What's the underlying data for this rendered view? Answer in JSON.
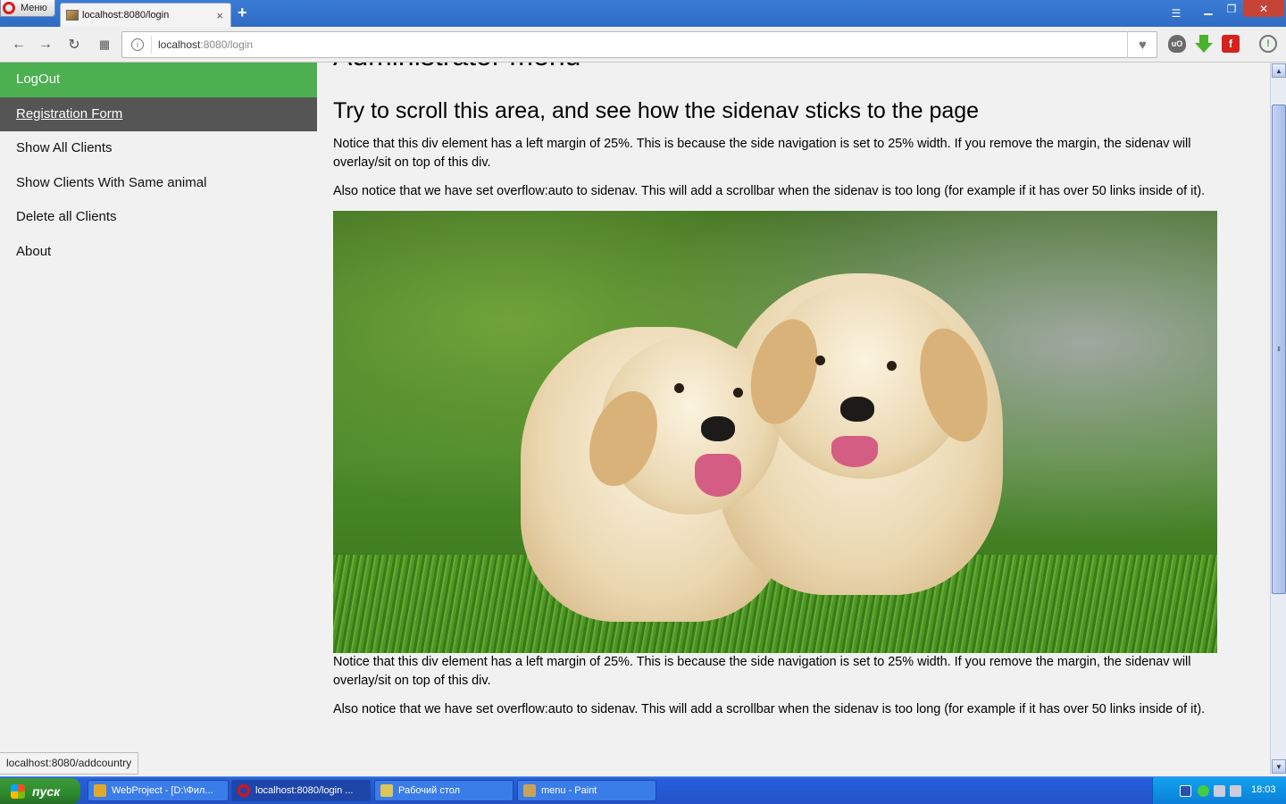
{
  "browser": {
    "menu_label": "Меню",
    "tab_title": "localhost:8080/login",
    "tab_close": "×",
    "new_tab": "+",
    "url_host": "localhost",
    "url_path": ":8080/login",
    "status_url": "localhost:8080/addcountry"
  },
  "sidenav": {
    "items": [
      {
        "label": "LogOut"
      },
      {
        "label": "Registration Form"
      },
      {
        "label": "Show All Clients"
      },
      {
        "label": "Show Clients With Same animal"
      },
      {
        "label": "Delete all Clients"
      },
      {
        "label": "About"
      }
    ]
  },
  "main": {
    "h1": "Administrator menu",
    "h2": "Try to scroll this area, and see how the sidenav sticks to the page",
    "p1": "Notice that this div element has a left margin of 25%. This is because the side navigation is set to 25% width. If you remove the margin, the sidenav will overlay/sit on top of this div.",
    "p2": "Also notice that we have set overflow:auto to sidenav. This will add a scrollbar when the sidenav is too long (for example if it has over 50 links inside of it).",
    "p3": "Notice that this div element has a left margin of 25%. This is because the side navigation is set to 25% width. If you remove the margin, the sidenav will overlay/sit on top of this div.",
    "p4": "Also notice that we have set overflow:auto to sidenav. This will add a scrollbar when the sidenav is too long (for example if it has over 50 links inside of it)."
  },
  "taskbar": {
    "start_label": "пуск",
    "tasks": [
      {
        "label": "WebProject - [D:\\Фил..."
      },
      {
        "label": "localhost:8080/login ..."
      },
      {
        "label": "Рабочий стол"
      },
      {
        "label": "menu - Paint"
      }
    ],
    "clock": "18:03"
  },
  "colors": {
    "active_nav": "#4caf50",
    "current_nav": "#555555",
    "title_bar": "#2f6cc4"
  }
}
